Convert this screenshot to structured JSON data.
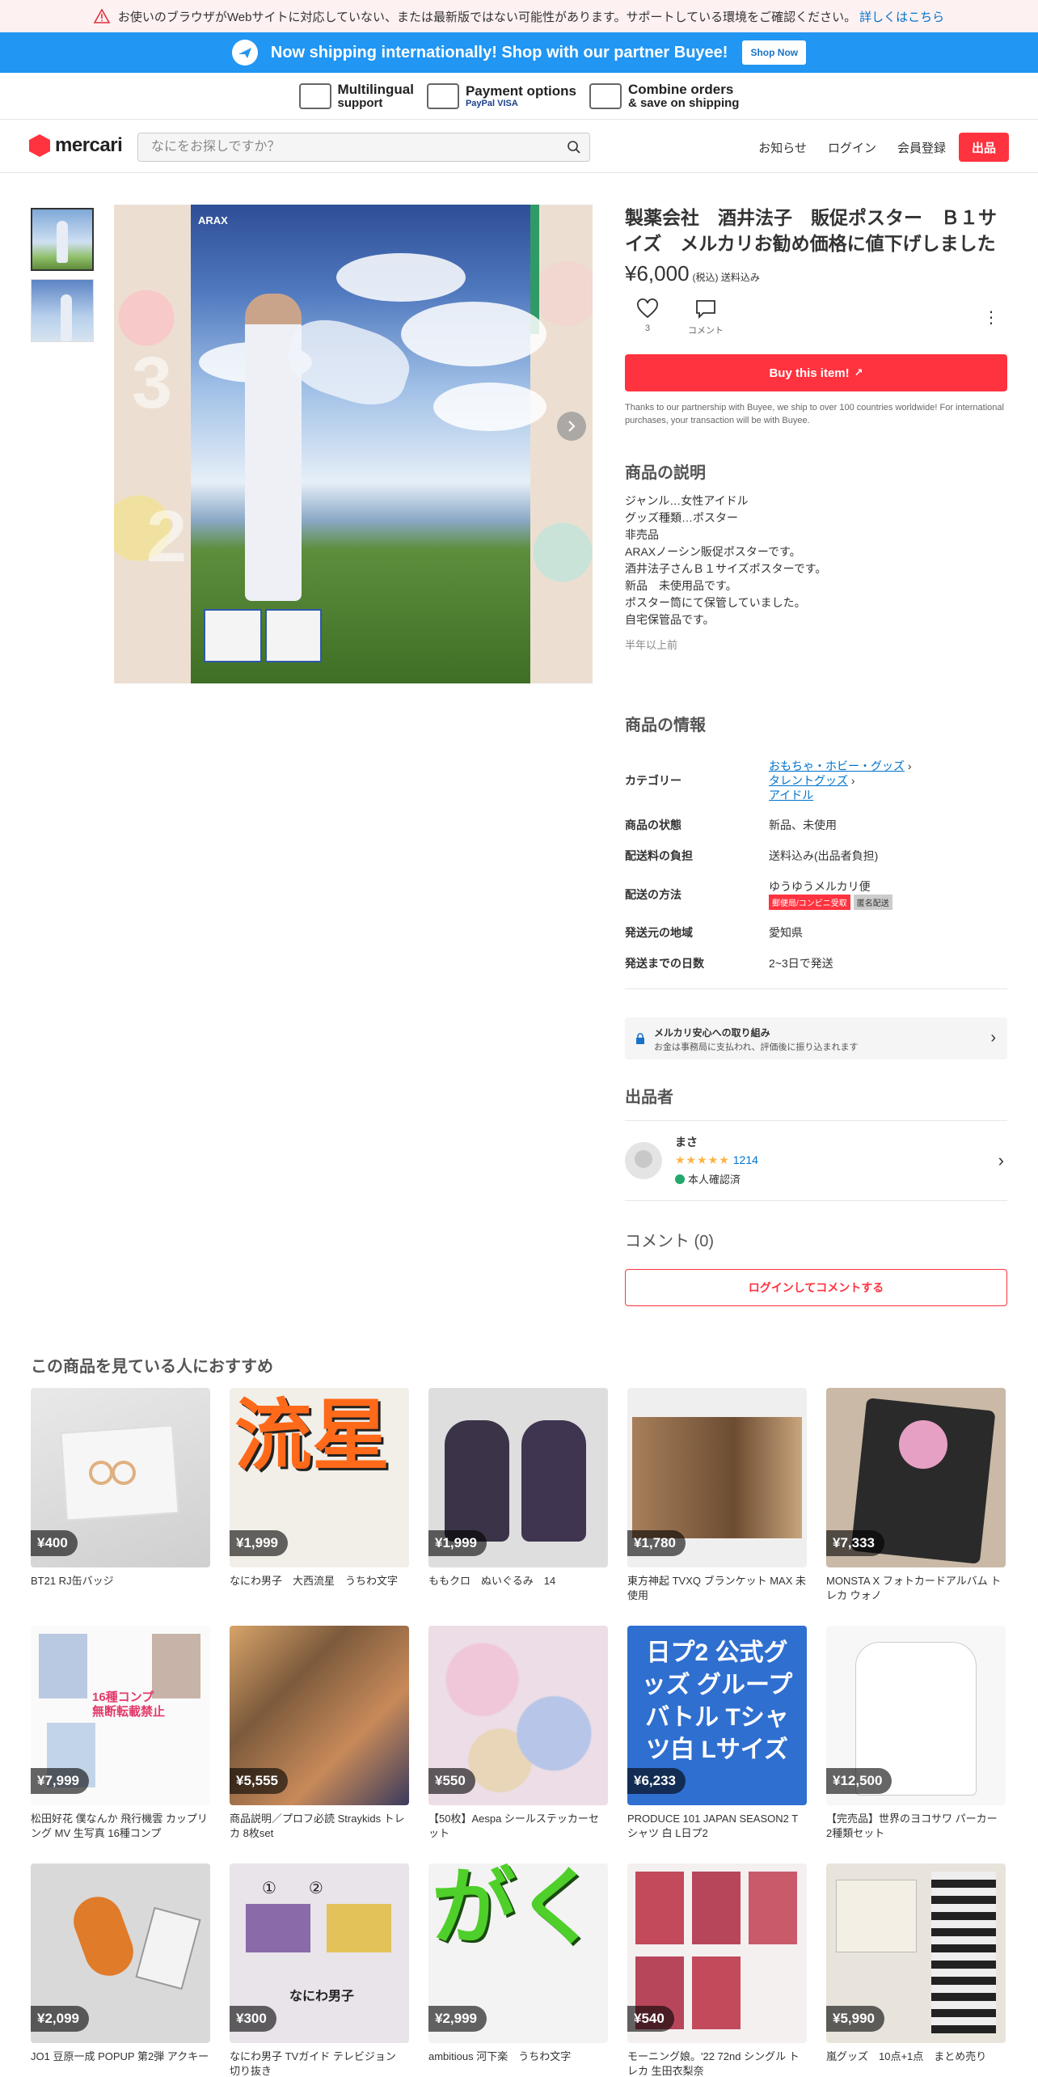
{
  "warning": {
    "text": "お使いのブラウザがWebサイトに対応していない、または最新版ではない可能性があります。サポートしている環境をご確認ください。",
    "link": "詳しくはこちら"
  },
  "shipping_banner": {
    "text": "Now shipping internationally! Shop with our partner Buyee!",
    "button": "Shop Now"
  },
  "features": [
    {
      "line1": "Multilingual",
      "line2": "support",
      "icon": "translate-icon"
    },
    {
      "line1": "Payment options",
      "line2": "PayPal VISA",
      "icon": "card-icon"
    },
    {
      "line1": "Combine orders",
      "line2": "& save on shipping",
      "icon": "box-icon"
    }
  ],
  "header": {
    "logo": "mercari",
    "search_placeholder": "なにをお探しですか？",
    "nav": {
      "news": "お知らせ",
      "login": "ログイン",
      "signup": "会員登録",
      "sell": "出品"
    }
  },
  "product": {
    "title": "製薬会社　酒井法子　販促ポスター　Ｂ１サイズ　メルカリお勧め価格に値下げしました",
    "price": "¥6,000",
    "price_note": "(税込) 送料込み",
    "likes": "3",
    "comment_label": "コメント",
    "buy_button": "Buy this item!",
    "buyee_note": "Thanks to our partnership with Buyee, we ship to over 100 countries worldwide! For international purchases, your transaction will be with Buyee.",
    "image_brand": "ARAX"
  },
  "description": {
    "heading": "商品の説明",
    "lines": [
      "ジャンル…女性アイドル",
      "グッズ種類…ポスター",
      "非売品",
      "ARAXノーシン販促ポスターです。",
      "酒井法子さんＢ１サイズポスターです。",
      "新品　未使用品です。",
      "ポスター筒にて保管していました。",
      "自宅保管品です。"
    ],
    "posted": "半年以上前"
  },
  "info": {
    "heading": "商品の情報",
    "category_label": "カテゴリー",
    "categories": [
      "おもちゃ・ホビー・グッズ",
      "タレントグッズ",
      "アイドル"
    ],
    "rows": [
      {
        "k": "商品の状態",
        "v": "新品、未使用"
      },
      {
        "k": "配送料の負担",
        "v": "送料込み(出品者負担)"
      },
      {
        "k": "配送の方法",
        "v": "ゆうゆうメルカリ便"
      },
      {
        "k": "発送元の地域",
        "v": "愛知県"
      },
      {
        "k": "発送までの日数",
        "v": "2~3日で発送"
      }
    ],
    "shipping_tags": [
      "郵便局/コンビニ受取",
      "匿名配送"
    ]
  },
  "safety": {
    "title": "メルカリ安心への取り組み",
    "sub": "お金は事務局に支払われ、評価後に振り込まれます"
  },
  "seller": {
    "heading": "出品者",
    "name": "まさ",
    "stars": "★★★★★",
    "rating_count": "1214",
    "verified": "本人確認済"
  },
  "comments": {
    "heading": "コメント (0)",
    "login_button": "ログインしてコメントする"
  },
  "recommend": {
    "heading": "この商品を見ている人におすすめ",
    "items": [
      {
        "price": "¥400",
        "name": "BT21 RJ缶バッジ"
      },
      {
        "price": "¥1,999",
        "name": "なにわ男子　大西流星　うちわ文字"
      },
      {
        "price": "¥1,999",
        "name": "ももクロ　ぬいぐるみ　14"
      },
      {
        "price": "¥1,780",
        "name": "東方神起 TVXQ ブランケット MAX 未使用"
      },
      {
        "price": "¥7,333",
        "name": "MONSTA X フォトカードアルバム トレカ ウォノ"
      },
      {
        "price": "¥7,999",
        "name": "松田好花 僕なんか 飛行機雲 カップリング MV 生写真 16種コンプ"
      },
      {
        "price": "¥5,555",
        "name": "商品説明／プロフ必読 Straykids トレカ 8枚set"
      },
      {
        "price": "¥550",
        "name": "【50枚】Aespa シールステッカーセット"
      },
      {
        "price": "¥6,233",
        "name": "PRODUCE 101 JAPAN SEASON2 Tシャツ 白 L日プ2"
      },
      {
        "price": "¥12,500",
        "name": "【完売品】世界のヨコサワ パーカー 2種類セット"
      },
      {
        "price": "¥2,099",
        "name": "JO1 豆原一成 POPUP 第2弾 アクキー"
      },
      {
        "price": "¥300",
        "name": "なにわ男子 TVガイド テレビジョン 切り抜き"
      },
      {
        "price": "¥2,999",
        "name": "ambitious 河下楽　うちわ文字"
      },
      {
        "price": "¥540",
        "name": "モーニング娘。'22 72nd シングル トレカ 生田衣梨奈"
      },
      {
        "price": "¥5,990",
        "name": "嵐グッズ　10点+1点　まとめ売り"
      }
    ],
    "image_text": {
      "ryusei": "流星",
      "nipu": "日プ2 公式グッズ グループバトル Tシャツ白 Lサイズ",
      "ga": "がく",
      "naniwa": "なにわ男子",
      "nums": "①　　②",
      "comp": "16種コンプ 無断転載禁止"
    }
  }
}
